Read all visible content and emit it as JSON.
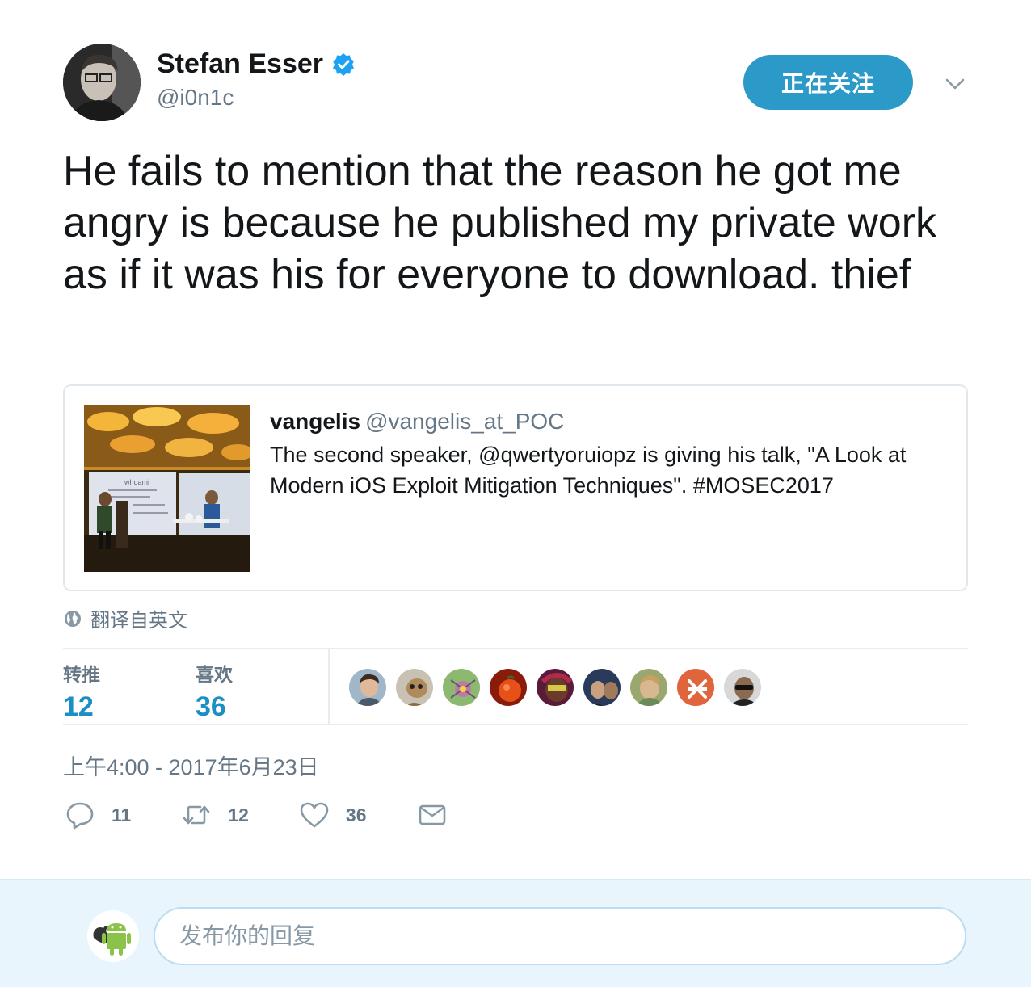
{
  "author": {
    "name": "Stefan Esser",
    "handle": "@i0n1c",
    "follow_label": "正在关注"
  },
  "tweet": {
    "text": "He fails to mention that the reason he got me angry is because he published my private work as if it was his for everyone to download. thief"
  },
  "quoted": {
    "name": "vangelis",
    "handle": "@vangelis_at_POC",
    "text": "The second speaker, @qwertyoruiopz is giving his talk, \"A Look at Modern iOS Exploit Mitigation Techniques\". #MOSEC2017",
    "image_slide_text": "whoami"
  },
  "translate_label": "翻译自英文",
  "stats": {
    "retweets_label": "转推",
    "retweets": "12",
    "likes_label": "喜欢",
    "likes": "36"
  },
  "timestamp": "上午4:00 - 2017年6月23日",
  "actions": {
    "replies": "11",
    "retweets": "12",
    "likes": "36"
  },
  "reply": {
    "placeholder": "发布你的回复"
  },
  "icons": [
    "verified-icon",
    "chevron-down-icon",
    "globe-icon",
    "reply-icon",
    "retweet-icon",
    "heart-icon",
    "mail-icon"
  ],
  "colors": {
    "accent": "#1b8fc4",
    "follow_button": "#2b9ac9",
    "muted": "#657786",
    "reply_bar": "#e8f5fd"
  }
}
